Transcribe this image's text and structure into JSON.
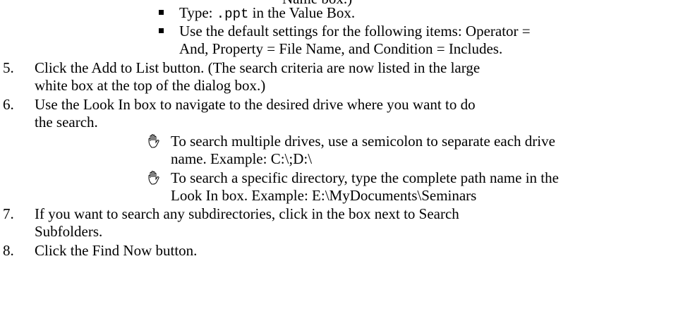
{
  "top_clipped": "Name box.)",
  "sub_bullets": [
    {
      "lines": [
        {
          "pre": "Type: ",
          "code": ".ppt",
          "post": " in the Value Box."
        }
      ]
    },
    {
      "lines": [
        {
          "text": "Use the default settings for the following items:  Operator ="
        },
        {
          "text": "And, Property = File Name, and Condition = Includes."
        }
      ]
    }
  ],
  "steps": [
    {
      "number": "5.",
      "lines": [
        "Click the Add to List button.  (The search criteria are now listed in the large",
        "white box at the top of the dialog box.)"
      ]
    },
    {
      "number": "6.",
      "lines": [
        "Use the Look In box to navigate to the desired drive where you want to do",
        "the search."
      ]
    },
    {
      "number": "7.",
      "lines": [
        "If you want to search any subdirectories, click in the box next to Search",
        "Subfolders."
      ]
    },
    {
      "number": "8.",
      "lines": [
        "Click the Find Now button."
      ]
    }
  ],
  "tips": [
    {
      "icon": "hand-icon",
      "lines": [
        "To search multiple drives, use a semicolon to separate each drive",
        "name.  Example:  C:\\;D:\\"
      ]
    },
    {
      "icon": "hand-icon",
      "lines": [
        "To search a specific directory, type the complete path name in the",
        "Look In box.  Example:  E:\\MyDocuments\\Seminars"
      ]
    }
  ]
}
